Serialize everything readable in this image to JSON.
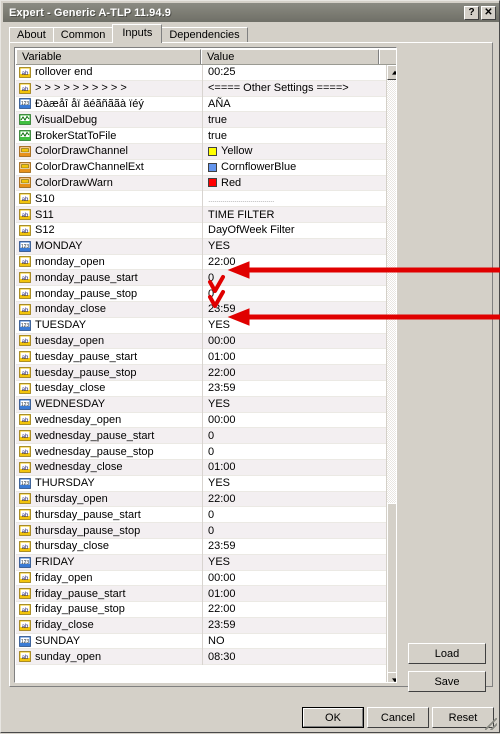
{
  "window": {
    "title": "Expert - Generic A-TLP 11.94.9",
    "help_button": "?",
    "close_button": "✕"
  },
  "tabs": [
    {
      "label": "About",
      "active": false
    },
    {
      "label": "Common",
      "active": false
    },
    {
      "label": "Inputs",
      "active": true
    },
    {
      "label": "Dependencies",
      "active": false
    }
  ],
  "grid": {
    "headers": {
      "variable": "Variable",
      "value": "Value"
    },
    "rows": [
      {
        "icon": "string-ab-icon",
        "name": "rollover end",
        "value": "00:25"
      },
      {
        "icon": "string-ab-icon",
        "name": ">  >  >  >  >  >  >  >  >  >",
        "value": "<==== Other Settings ====>"
      },
      {
        "icon": "integer-123-icon",
        "name": "Ðàæåî åï ãéãñããà ïéý",
        "value": "AÑA"
      },
      {
        "icon": "bool-wave-icon",
        "name": "VisualDebug",
        "value": "true"
      },
      {
        "icon": "bool-wave-icon",
        "name": "BrokerStatToFile",
        "value": "true"
      },
      {
        "icon": "color-icon",
        "name": "ColorDrawChannel",
        "value": "Yellow",
        "swatch": "#FFFF00"
      },
      {
        "icon": "color-icon",
        "name": "ColorDrawChannelExt",
        "value": "CornflowerBlue",
        "swatch": "#6495ED"
      },
      {
        "icon": "color-icon",
        "name": "ColorDrawWarn",
        "value": "Red",
        "swatch": "#FF0000"
      },
      {
        "icon": "string-ab-icon",
        "name": "S10",
        "value": ".................................",
        "dim": true
      },
      {
        "icon": "string-ab-icon",
        "name": "S11",
        "value": "TIME FILTER"
      },
      {
        "icon": "string-ab-icon",
        "name": "S12",
        "value": "DayOfWeek Filter"
      },
      {
        "icon": "integer-123-icon",
        "name": "MONDAY",
        "value": "YES"
      },
      {
        "icon": "string-ab-icon",
        "name": "monday_open",
        "value": "22:00"
      },
      {
        "icon": "string-ab-icon",
        "name": "monday_pause_start",
        "value": "0"
      },
      {
        "icon": "string-ab-icon",
        "name": "monday_pause_stop",
        "value": "0"
      },
      {
        "icon": "string-ab-icon",
        "name": "monday_close",
        "value": "23:59"
      },
      {
        "icon": "integer-123-icon",
        "name": "TUESDAY",
        "value": "YES"
      },
      {
        "icon": "string-ab-icon",
        "name": "tuesday_open",
        "value": "00:00"
      },
      {
        "icon": "string-ab-icon",
        "name": "tuesday_pause_start",
        "value": "01:00"
      },
      {
        "icon": "string-ab-icon",
        "name": "tuesday_pause_stop",
        "value": "22:00"
      },
      {
        "icon": "string-ab-icon",
        "name": "tuesday_close",
        "value": "23:59"
      },
      {
        "icon": "integer-123-icon",
        "name": "WEDNESDAY",
        "value": "YES"
      },
      {
        "icon": "string-ab-icon",
        "name": "wednesday_open",
        "value": "00:00"
      },
      {
        "icon": "string-ab-icon",
        "name": "wednesday_pause_start",
        "value": "0"
      },
      {
        "icon": "string-ab-icon",
        "name": "wednesday_pause_stop",
        "value": "0"
      },
      {
        "icon": "string-ab-icon",
        "name": "wednesday_close",
        "value": "01:00"
      },
      {
        "icon": "integer-123-icon",
        "name": "THURSDAY",
        "value": "YES"
      },
      {
        "icon": "string-ab-icon",
        "name": "thursday_open",
        "value": "22:00"
      },
      {
        "icon": "string-ab-icon",
        "name": "thursday_pause_start",
        "value": "0"
      },
      {
        "icon": "string-ab-icon",
        "name": "thursday_pause_stop",
        "value": "0"
      },
      {
        "icon": "string-ab-icon",
        "name": "thursday_close",
        "value": "23:59"
      },
      {
        "icon": "integer-123-icon",
        "name": "FRIDAY",
        "value": "YES"
      },
      {
        "icon": "string-ab-icon",
        "name": "friday_open",
        "value": "00:00"
      },
      {
        "icon": "string-ab-icon",
        "name": "friday_pause_start",
        "value": "01:00"
      },
      {
        "icon": "string-ab-icon",
        "name": "friday_pause_stop",
        "value": "22:00"
      },
      {
        "icon": "string-ab-icon",
        "name": "friday_close",
        "value": "23:59"
      },
      {
        "icon": "integer-123-icon",
        "name": "SUNDAY",
        "value": "NO"
      },
      {
        "icon": "string-ab-icon",
        "name": "sunday_open",
        "value": "08:30"
      }
    ]
  },
  "side_buttons": {
    "load": "Load",
    "save": "Save"
  },
  "bottom_buttons": {
    "ok": "OK",
    "cancel": "Cancel",
    "reset": "Reset"
  },
  "annotations": {
    "color": "#E00000",
    "arrow_targets": [
      "monday_open",
      "monday_close"
    ],
    "check_targets": [
      "monday_pause_start",
      "monday_pause_stop"
    ]
  }
}
